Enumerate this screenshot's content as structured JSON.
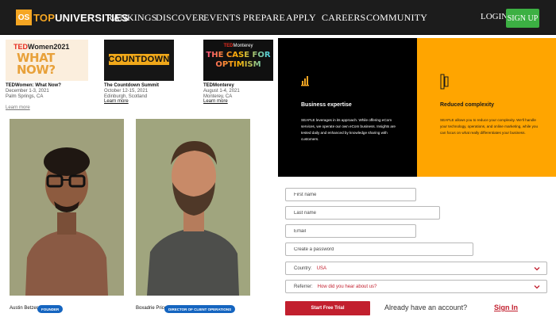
{
  "nav": {
    "logo_badge": "OS",
    "logo_top": "TOP",
    "logo_universities": "UNIVERSITIES",
    "items": [
      "RANKINGS",
      "DISCOVER",
      "EVENTS",
      "PREPARE",
      "APPLY",
      "CAREERS",
      "COMMUNITY"
    ],
    "login": "LOGIN",
    "signup": "SIGN UP"
  },
  "events": [
    {
      "thumb_brand": "TED",
      "thumb_brand_rest": "Women2021",
      "thumb_line1": "WHAT",
      "thumb_line2": "NOW?",
      "title": "TEDWomen: What Now?",
      "date": "December 1-3, 2021",
      "place": "Palm Springs, CA",
      "link": "Learn more"
    },
    {
      "thumb_word": "COUNTDOWN",
      "title": "The Countdown Summit",
      "date": "October 12-15, 2021",
      "place": "Edinburgh, Scotland",
      "link": "Learn more"
    },
    {
      "thumb_brand": "TED",
      "thumb_brand_rest": "Monterey",
      "thumb_line1": "THE CASE FOR",
      "thumb_line2": "OPTIMISM",
      "title": "TEDMonterey",
      "date": "August 1-4, 2021",
      "place": "Monterey, CA",
      "link": "Learn more"
    }
  ],
  "team": [
    {
      "name": "Austin Betzer",
      "role": "FOUNDER"
    },
    {
      "name": "Boxadrie Price",
      "role": "DIRECTOR OF CLIENT OPERATIONS"
    }
  ],
  "panels": {
    "left": {
      "title": "Business expertise",
      "body": "SEAFLE leverages in its approach. While offering eCom services, we operate our own eCom business. Insights are tested daily and enhanced by knowledge sharing with customers."
    },
    "right": {
      "title": "Reduced complexity",
      "body": "SEAFLE allows you to reduce your complexity. We'll handle your technology, operations, and online marketing, while you can focus on what really differentiates your business."
    }
  },
  "form": {
    "first_name": "First name",
    "last_name": "Last name",
    "email": "Email",
    "password": "Create a password",
    "country_label": "Country:",
    "country_value": "USA",
    "referrer_label": "Referrer:",
    "referrer_value": "How did you hear about us?",
    "submit": "Start Free Trial",
    "already": "Already have an account?",
    "signin": "Sign In"
  },
  "colors": {
    "nav_bg": "#1c1c1c",
    "brand_orange": "#f5a623",
    "signup_green": "#3cb043",
    "panel_orange": "#ffa500",
    "accent_red": "#c21f2e",
    "badge_blue": "#1565c0"
  }
}
